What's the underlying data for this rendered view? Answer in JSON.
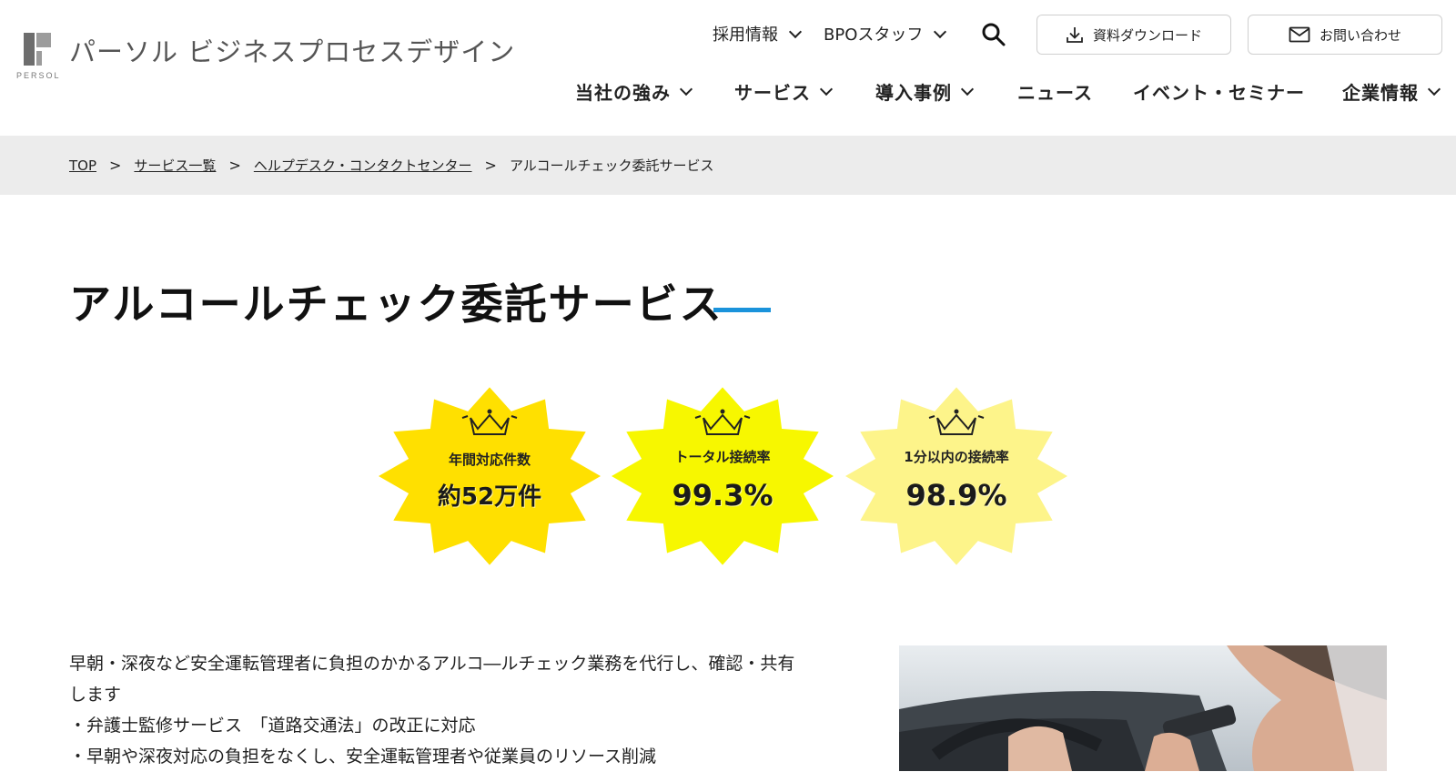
{
  "header": {
    "logo_word": "PERSOL",
    "site_name": "パーソル ビジネスプロセスデザイン",
    "util_nav": [
      {
        "label": "採用情報"
      },
      {
        "label": "BPOスタッフ"
      }
    ],
    "download_label": "資料ダウンロード",
    "contact_label": "お問い合わせ",
    "main_nav": [
      {
        "label": "当社の強み"
      },
      {
        "label": "サービス"
      },
      {
        "label": "導入事例"
      },
      {
        "label": "ニュース"
      },
      {
        "label": "イベント・セミナー"
      },
      {
        "label": "企業情報"
      }
    ],
    "icons": {
      "search": "search-icon",
      "download": "download-icon",
      "mail": "mail-icon"
    }
  },
  "breadcrumb": [
    {
      "label": "TOP"
    },
    {
      "label": "サービス一覧"
    },
    {
      "label": "ヘルプデスク・コンタクトセンター"
    },
    {
      "label": "アルコールチェック委託サービス"
    }
  ],
  "breadcrumb_sep": ">",
  "page": {
    "title": "アルコールチェック委託サービス",
    "accent_color": "#1a93db"
  },
  "stats": [
    {
      "label": "年間対応件数",
      "value": "約52万件",
      "color": "#ffe000"
    },
    {
      "label": "トータル接続率",
      "value": "99.3%",
      "color": "#f7f700"
    },
    {
      "label": "1分以内の接続率",
      "value": "98.9%",
      "color": "#fdf48a"
    }
  ],
  "intro": {
    "line1": "早朝・深夜など安全運転管理者に負担のかかるアルコ―ルチェック業務を代行し、確認・共有",
    "line2": "します",
    "line3": "・弁護士監修サービス　「道路交通法」の改正に対応",
    "line4": "・早朝や深夜対応の負担をなくし、安全運転管理者や従業員のリソース削減"
  }
}
